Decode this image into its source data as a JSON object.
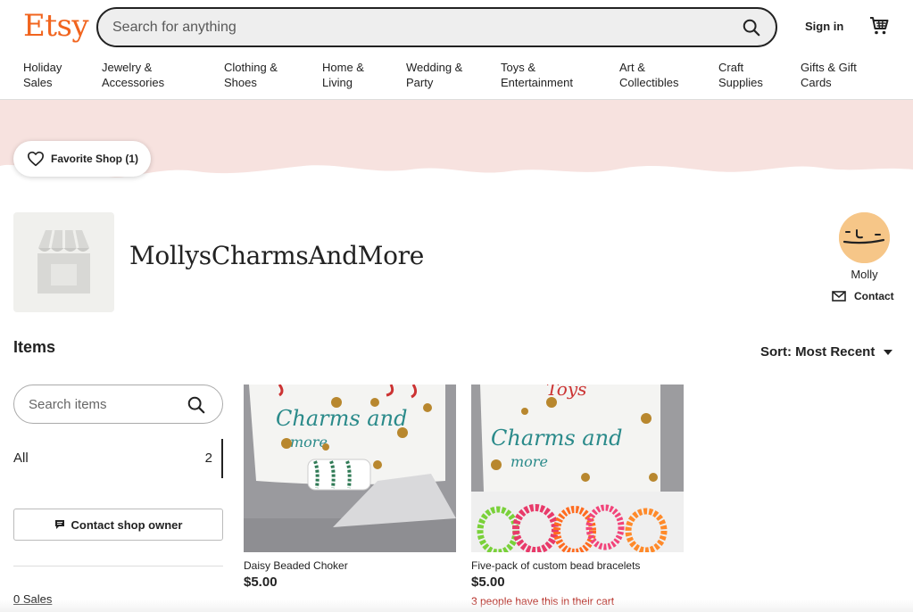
{
  "header": {
    "logo": "Etsy",
    "search_placeholder": "Search for anything",
    "signin_label": "Sign in"
  },
  "categories": [
    {
      "line1": "Holiday",
      "line2": "Sales"
    },
    {
      "line1": "Jewelry &",
      "line2": "Accessories"
    },
    {
      "line1": "Clothing &",
      "line2": "Shoes"
    },
    {
      "line1": "Home &",
      "line2": "Living"
    },
    {
      "line1": "Wedding &",
      "line2": "Party"
    },
    {
      "line1": "Toys &",
      "line2": "Entertainment"
    },
    {
      "line1": "Art &",
      "line2": "Collectibles"
    },
    {
      "line1": "Craft",
      "line2": "Supplies"
    },
    {
      "line1": "Gifts & Gift",
      "line2": "Cards"
    }
  ],
  "shop": {
    "favorite_label": "Favorite Shop (1)",
    "name": "MollysCharmsAndMore",
    "owner_name": "Molly",
    "contact_label": "Contact"
  },
  "items": {
    "title": "Items",
    "sort_label": "Sort: Most Recent",
    "search_placeholder": "Search items",
    "all_label": "All",
    "all_count": "2",
    "contact_owner_label": "Contact shop owner",
    "sales_label": "0 Sales"
  },
  "listings": [
    {
      "title": "Daisy Beaded Choker",
      "price": "$5.00",
      "note": ""
    },
    {
      "title": "Five-pack of custom bead bracelets",
      "price": "$5.00",
      "note": "3 people have this in their cart"
    }
  ],
  "image_text": {
    "sign_line1": "Charms and",
    "sign_line2": "more",
    "sign_top": "Toys"
  },
  "colors": {
    "brand": "#f1641e",
    "banner": "#f7e2df",
    "cart_note": "#b3261e"
  }
}
